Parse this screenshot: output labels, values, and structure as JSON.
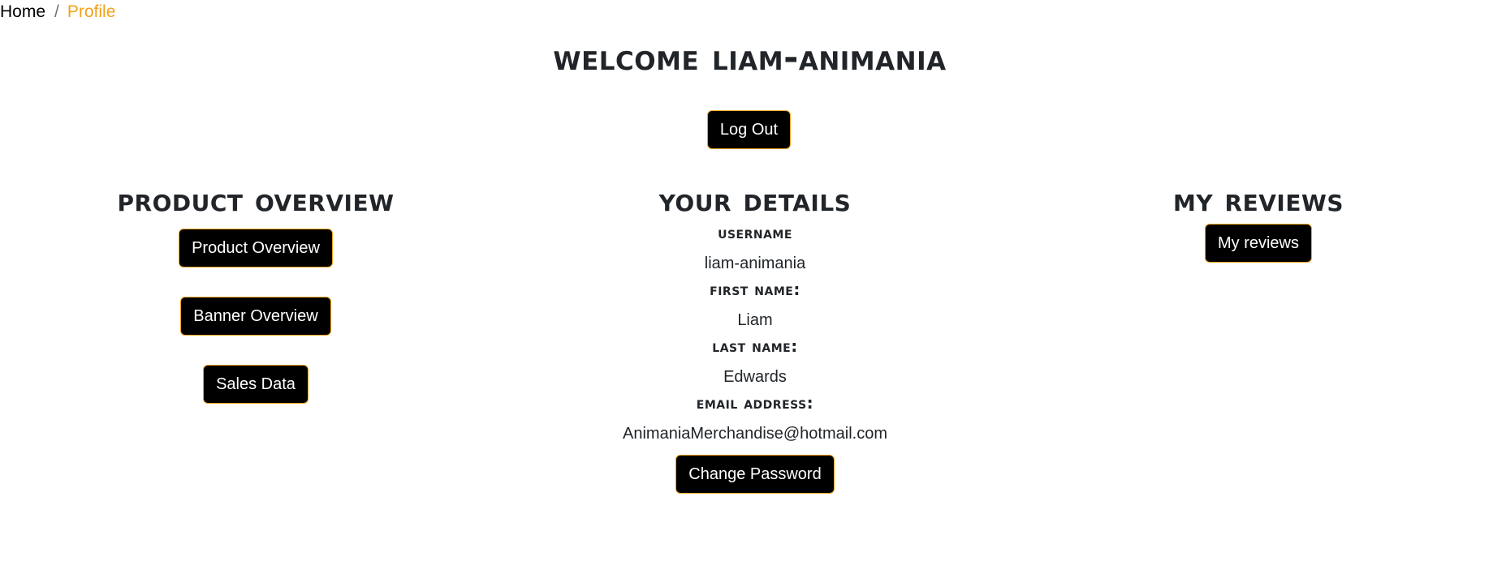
{
  "breadcrumb": {
    "home_label": "Home",
    "separator": "/",
    "current_label": "Profile"
  },
  "welcome_title": "Welcome liam-animania",
  "logout_label": "Log Out",
  "product_overview": {
    "heading": "Product Overview",
    "buttons": [
      "Product Overview",
      "Banner Overview",
      "Sales Data"
    ]
  },
  "details": {
    "heading": "Your Details",
    "username_label": "Username",
    "username_value": "liam-animania",
    "first_name_label": "First Name:",
    "first_name_value": "Liam",
    "last_name_label": "Last Name:",
    "last_name_value": "Edwards",
    "email_label": "Email Address:",
    "email_value": "AnimaniaMerchandise@hotmail.com",
    "change_password_label": "Change Password"
  },
  "reviews": {
    "heading": "My Reviews",
    "button_label": "My reviews"
  },
  "colors": {
    "accent": "#f0a21a",
    "button_bg": "#000000",
    "text": "#212529"
  }
}
